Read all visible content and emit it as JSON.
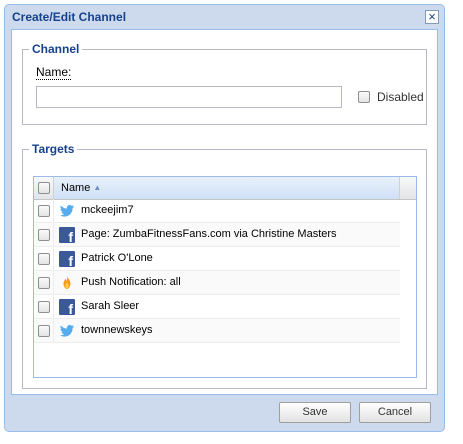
{
  "window": {
    "title": "Create/Edit Channel"
  },
  "channel": {
    "legend": "Channel",
    "name_label": "Name:",
    "name_value": "",
    "disabled_label": "Disabled",
    "disabled_checked": false
  },
  "targets": {
    "legend": "Targets",
    "column_header": "Name",
    "sort_direction": "ascending",
    "rows": [
      {
        "icon": "twitter-icon",
        "label": "mckeejim7",
        "checked": false
      },
      {
        "icon": "facebook-icon",
        "label": "Page: ZumbaFitnessFans.com via Christine Masters",
        "checked": false
      },
      {
        "icon": "facebook-icon",
        "label": "Patrick O'Lone",
        "checked": false
      },
      {
        "icon": "push-notification-icon",
        "label": "Push Notification: all",
        "checked": false
      },
      {
        "icon": "facebook-icon",
        "label": "Sarah Sleer",
        "checked": false
      },
      {
        "icon": "twitter-icon",
        "label": "townnewskeys",
        "checked": false
      }
    ]
  },
  "buttons": {
    "save": "Save",
    "cancel": "Cancel"
  },
  "colors": {
    "title": "#15428b",
    "window_bg": "#cdd9ec",
    "facebook": "#3b5998",
    "twitter": "#55acee"
  }
}
